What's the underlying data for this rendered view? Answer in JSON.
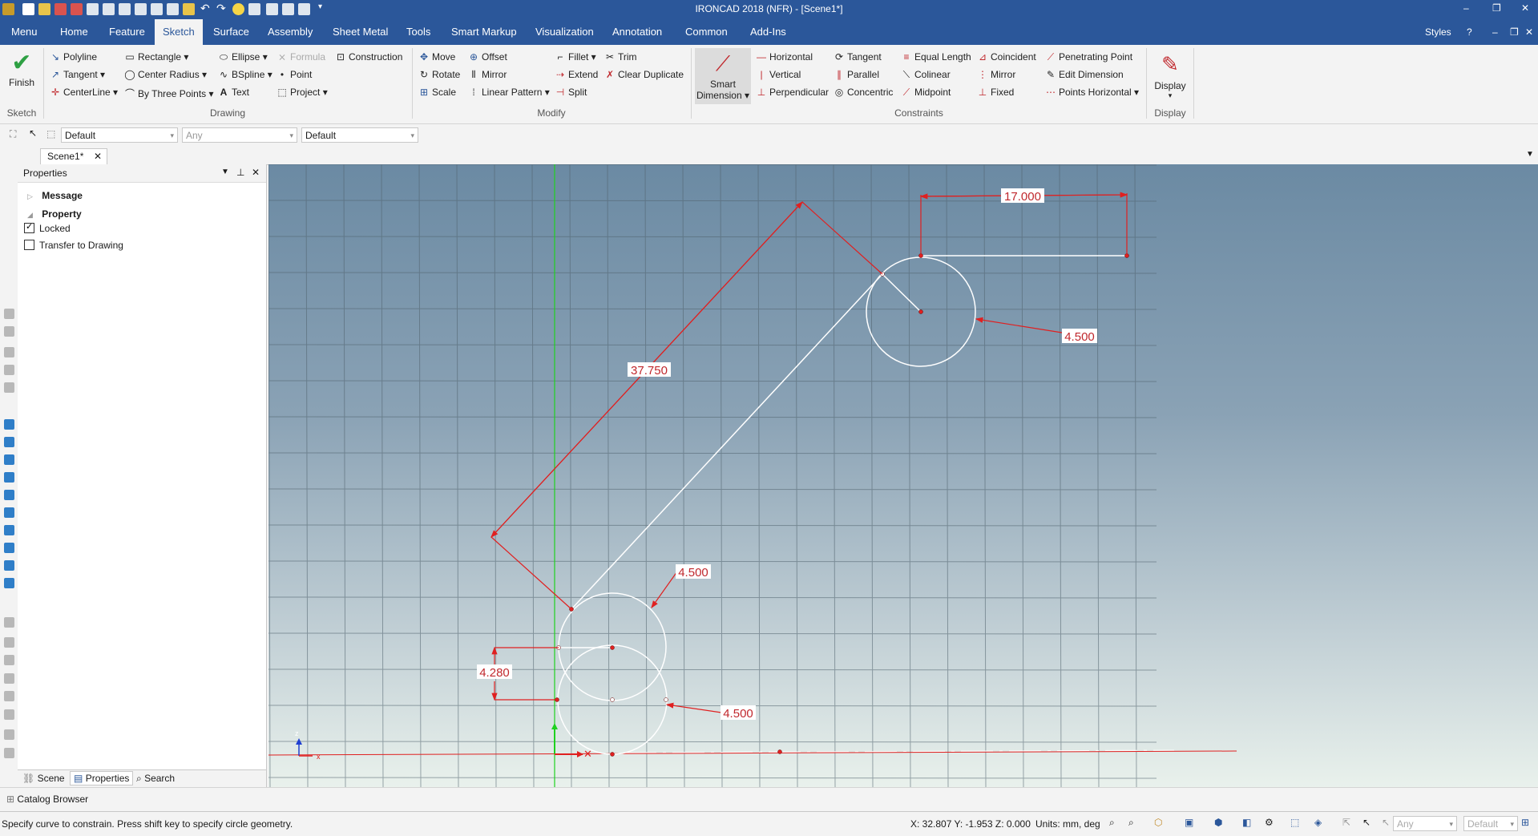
{
  "app": {
    "title": "IRONCAD 2018 (NFR) - [Scene1*]",
    "styles_label": "Styles"
  },
  "tabs": [
    "Menu",
    "Home",
    "Feature",
    "Sketch",
    "Surface",
    "Assembly",
    "Sheet Metal",
    "Tools",
    "Smart Markup",
    "Visualization",
    "Annotation",
    "Common",
    "Add-Ins"
  ],
  "active_tab": "Sketch",
  "ribbon": {
    "sketch_group": {
      "finish": "Finish",
      "label": "Sketch"
    },
    "drawing_group": {
      "label": "Drawing",
      "polyline": "Polyline",
      "tangent": "Tangent",
      "centerline": "CenterLine",
      "rectangle": "Rectangle",
      "center_radius": "Center Radius",
      "by_three_points": "By Three Points",
      "ellipse": "Ellipse",
      "bspline": "BSpline",
      "text": "Text",
      "formula": "Formula",
      "point": "Point",
      "project": "Project",
      "construction": "Construction"
    },
    "modify_group": {
      "label": "Modify",
      "move": "Move",
      "rotate": "Rotate",
      "scale": "Scale",
      "offset": "Offset",
      "mirror": "Mirror",
      "linear_pattern": "Linear Pattern",
      "fillet": "Fillet",
      "extend": "Extend",
      "split": "Split",
      "trim": "Trim",
      "clear_duplicate": "Clear Duplicate"
    },
    "constraints_group": {
      "label": "Constraints",
      "smart_dimension_line1": "Smart",
      "smart_dimension_line2": "Dimension",
      "horizontal": "Horizontal",
      "vertical": "Vertical",
      "perpendicular": "Perpendicular",
      "tangent": "Tangent",
      "parallel": "Parallel",
      "concentric": "Concentric",
      "equal_length": "Equal Length",
      "colinear": "Colinear",
      "midpoint": "Midpoint",
      "coincident": "Coincident",
      "mirror": "Mirror",
      "fixed": "Fixed",
      "penetrating_point": "Penetrating Point",
      "edit_dimension": "Edit Dimension",
      "points_horizontal": "Points Horizontal"
    },
    "display_group": {
      "display": "Display",
      "label": "Display"
    }
  },
  "toolbar2": {
    "combo1": "Default",
    "combo2_placeholder": "Any",
    "combo3": "Default"
  },
  "doc_tab": "Scene1*",
  "properties": {
    "title": "Properties",
    "message": "Message",
    "property": "Property",
    "locked": "Locked",
    "locked_checked": true,
    "transfer": "Transfer to Drawing",
    "transfer_checked": false
  },
  "panel_tabs": [
    "Scene",
    "Properties",
    "Search"
  ],
  "catalog": "Catalog Browser",
  "status": {
    "message": "Specify curve to constrain. Press shift key to specify circle geometry.",
    "coords": "X: 32.807 Y: -1.953 Z: 0.000",
    "units": "Units: mm, deg",
    "combo_any": "Any",
    "combo_default": "Default"
  },
  "dimensions": {
    "d17": "17.000",
    "d4500_top": "4.500",
    "d37750": "37.750",
    "d4500_mid": "4.500",
    "d4280": "4.280",
    "d4500_low": "4.500"
  },
  "axis_labels": {
    "z": "z",
    "x": "x"
  },
  "colors": {
    "ribbon_blue": "#2b579a",
    "dimension_red": "#c0282d",
    "sketch_white": "#ffffff",
    "axis_green": "#1fd11f"
  }
}
